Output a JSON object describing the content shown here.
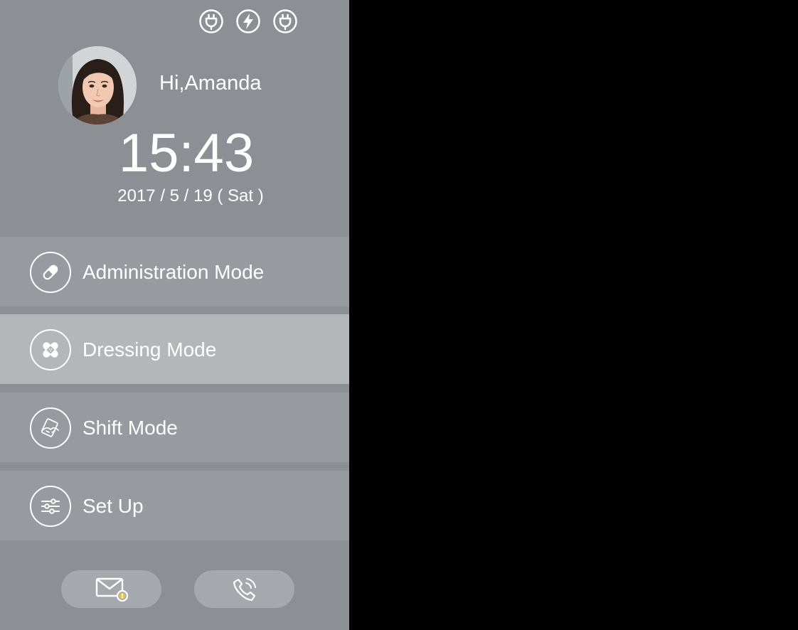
{
  "colors": {
    "panel_bg": "#8c8f93",
    "menu_bg": "#979a9e",
    "menu_active_bg": "#b4b7ba",
    "bottom_button_bg": "#a5a8ac",
    "screen_bg": "#000000",
    "text": "#ffffff"
  },
  "status_bar": {
    "icons": [
      "plug-icon",
      "lightning-icon",
      "plug-icon"
    ]
  },
  "user": {
    "greeting": "Hi,Amanda",
    "avatar_icon": "user-avatar"
  },
  "clock": {
    "time": "15:43",
    "date": "2017 / 5 / 19 ( Sat )"
  },
  "menu": [
    {
      "label": "Administration Mode",
      "icon": "pill-icon",
      "active": false
    },
    {
      "label": "Dressing Mode",
      "icon": "bandage-icon",
      "active": true
    },
    {
      "label": "Shift Mode",
      "icon": "handover-icon",
      "active": false
    },
    {
      "label": "Set Up",
      "icon": "sliders-icon",
      "active": false
    }
  ],
  "bottom_bar": {
    "buttons": [
      {
        "icon": "mail-alert-icon"
      },
      {
        "icon": "phone-call-icon"
      }
    ]
  }
}
